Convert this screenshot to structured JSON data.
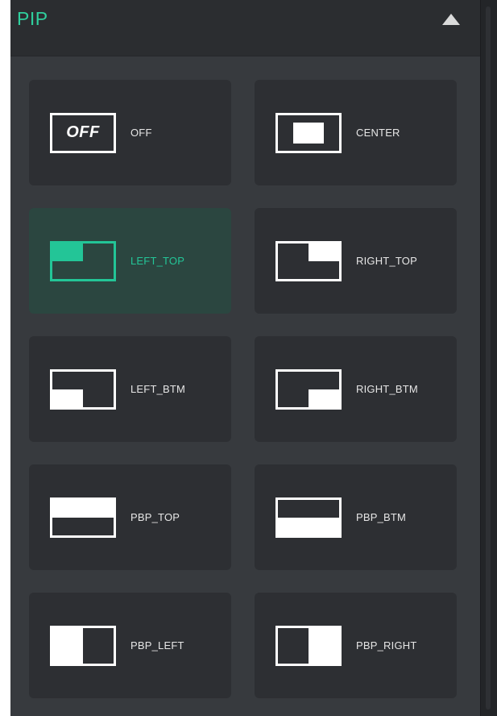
{
  "header": {
    "title": "PIP"
  },
  "tiles": [
    {
      "id": "off",
      "label": "OFF",
      "icon_text": "OFF",
      "icon": "pip-off-icon",
      "selected": false
    },
    {
      "id": "center",
      "label": "CENTER",
      "icon": "pip-center-icon",
      "selected": false
    },
    {
      "id": "left_top",
      "label": "LEFT_TOP",
      "icon": "pip-left-top-icon",
      "selected": true
    },
    {
      "id": "right_top",
      "label": "RIGHT_TOP",
      "icon": "pip-right-top-icon",
      "selected": false
    },
    {
      "id": "left_btm",
      "label": "LEFT_BTM",
      "icon": "pip-left-bottom-icon",
      "selected": false
    },
    {
      "id": "right_btm",
      "label": "RIGHT_BTM",
      "icon": "pip-right-bottom-icon",
      "selected": false
    },
    {
      "id": "pbp_top",
      "label": "PBP_TOP",
      "icon": "pbp-top-icon",
      "selected": false
    },
    {
      "id": "pbp_btm",
      "label": "PBP_BTM",
      "icon": "pbp-bottom-icon",
      "selected": false
    },
    {
      "id": "pbp_left",
      "label": "PBP_LEFT",
      "icon": "pbp-left-icon",
      "selected": false
    },
    {
      "id": "pbp_right",
      "label": "PBP_RIGHT",
      "icon": "pbp-right-icon",
      "selected": false
    }
  ],
  "colors": {
    "accent": "#23c597",
    "title": "#2fcf9d",
    "panel_bg": "#373a3e",
    "tile_bg": "#2d2f33",
    "tile_active_bg": "#2b4640",
    "icon_default": "#ffffff"
  }
}
